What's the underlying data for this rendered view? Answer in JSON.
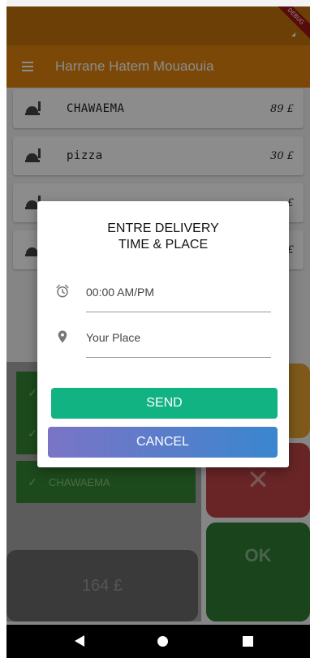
{
  "app": {
    "title": "Harrane Hatem Mouaouia",
    "debug_label": "DEBUG"
  },
  "products": [
    {
      "name": "CHAWAEMA",
      "price": "89 £"
    },
    {
      "name": "pizza",
      "price": "30 £"
    },
    {
      "name": "",
      "price": "£"
    },
    {
      "name": "",
      "price": "£"
    }
  ],
  "orders": [
    {
      "label": ""
    },
    {
      "label": ""
    },
    {
      "label": "CHAWAEMA"
    }
  ],
  "total": "164 £",
  "actions": {
    "clear_symbol": "✕",
    "ok_label": "OK"
  },
  "dialog": {
    "title": "ENTRE DELIVERY\nTIME & PLACE",
    "time_value": "00:00 AM/PM",
    "place_value": "Your Place",
    "send_label": "SEND",
    "cancel_label": "CANCEL"
  },
  "colors": {
    "status_bar": "#c5730d",
    "app_bar": "#e0830f",
    "order_item": "#368735",
    "send": "#12b382",
    "cancel_gradient": [
      "#7b74c6",
      "#3a86cf"
    ]
  },
  "icons": {
    "menu": "hamburger-icon",
    "product": "room-service-icon",
    "time": "alarm-clock-icon",
    "place": "location-pin-icon",
    "check": "check-icon",
    "clear": "close-icon"
  }
}
